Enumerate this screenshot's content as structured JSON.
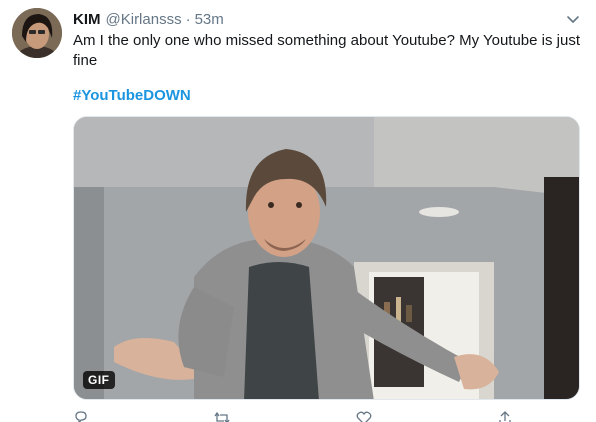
{
  "tweet": {
    "author_name": "KIM",
    "handle": "@Kirlansss",
    "separator": "·",
    "time": "53m",
    "text": "Am I the only one who missed something about Youtube? My Youtube is just fine",
    "hashtag": "#YouTubeDOWN",
    "media_badge": "GIF"
  },
  "colors": {
    "link": "#1b95e0",
    "secondary_text": "#657786",
    "primary_text": "#14171a"
  },
  "icons": [
    "chevron-down-icon",
    "reply-icon",
    "retweet-icon",
    "like-icon",
    "share-icon"
  ]
}
